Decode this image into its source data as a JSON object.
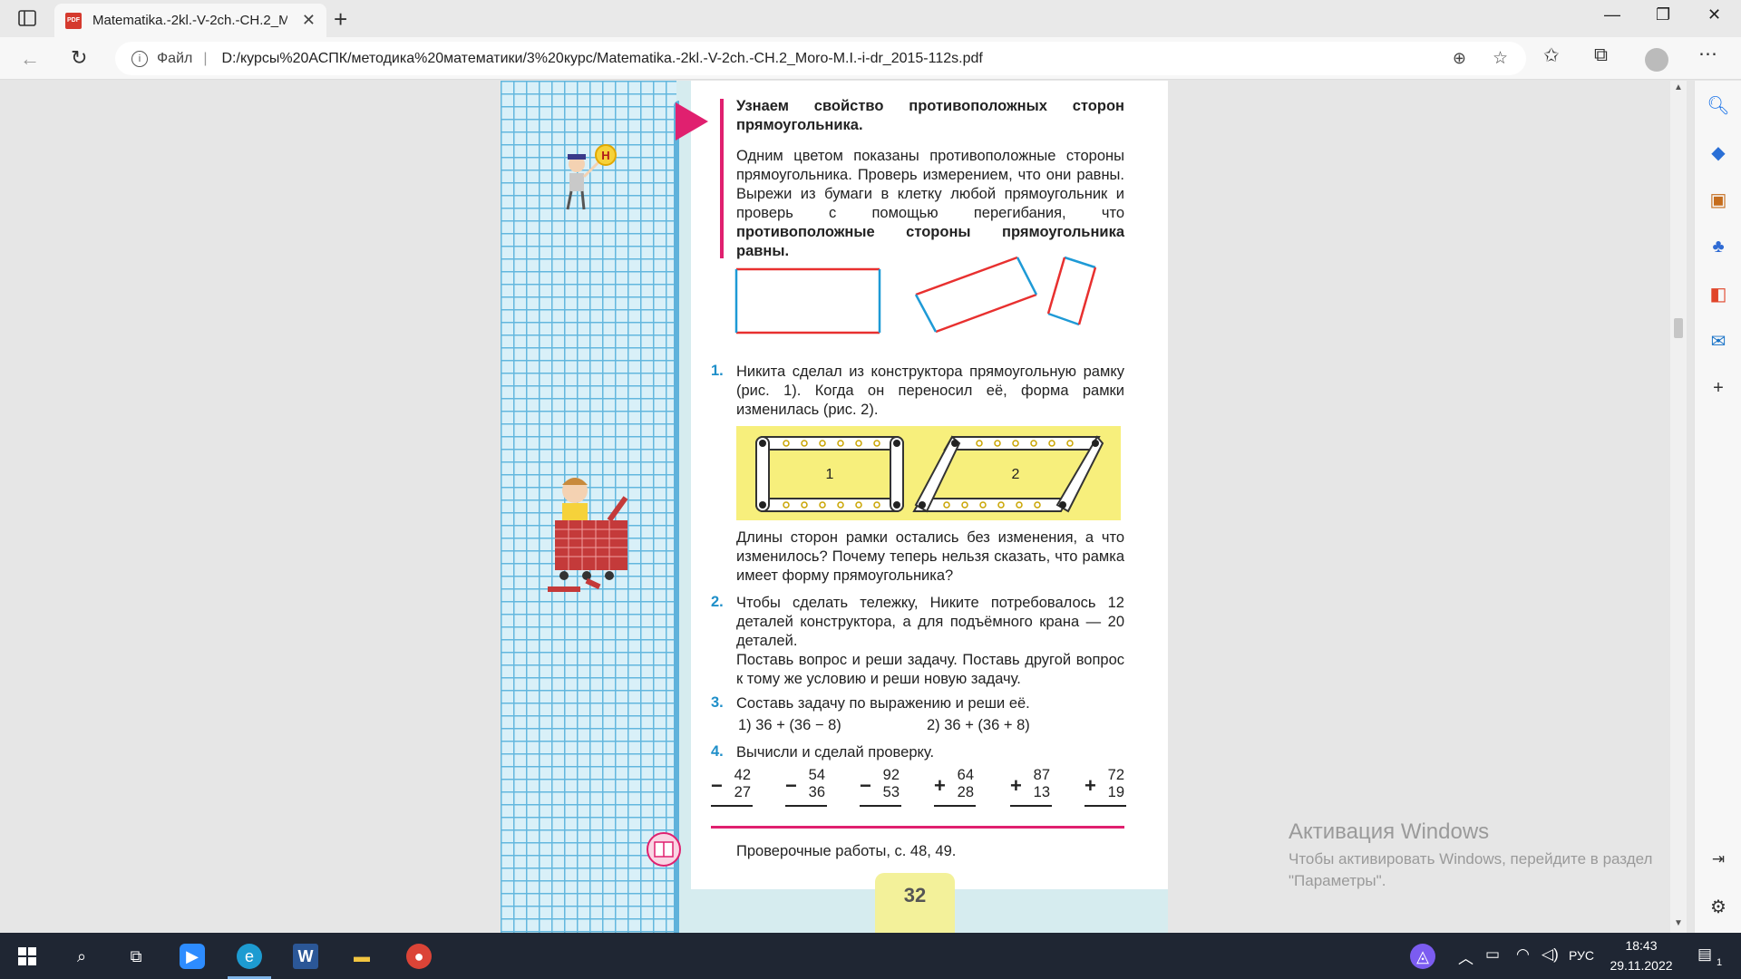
{
  "browser": {
    "tab_title": "Matematika.-2kl.-V-2ch.-CH.2_M",
    "pdf_badge": "PDF",
    "address_prefix": "Файл",
    "address_sep": "|",
    "url": "D:/курсы%20АСПК/методика%20математики/3%20курс/Matematika.-2kl.-V-2ch.-CH.2_Moro-M.I.-i-dr_2015-112s.pdf"
  },
  "page": {
    "intro_1": "Узнаем свойство противоположных сторон прямоугольника.",
    "intro_2_plain": "Одним цветом показаны противоположные стороны прямоугольника. Проверь измерением, что они равны. Вырежи из бумаги в клетку любой прямоугольник и проверь с помощью перегибания, что ",
    "intro_2_bold": "противоположные стороны прямоугольника равны.",
    "task1_num": "1.",
    "task1_text": "Никита сделал из конструктора прямоугольную рамку (рис. 1). Когда он переносил её, форма рамки изменилась (рис. 2).",
    "frame_label_1": "1",
    "frame_label_2": "2",
    "task1_question": "Длины сторон рамки остались без изменения, а что изменилось? Почему теперь нельзя сказать, что рамка имеет форму прямоугольника?",
    "task2_num": "2.",
    "task2_text": "Чтобы сделать тележку, Никите потребовалось 12 деталей конструктора, а для подъёмного крана — 20 деталей.",
    "task2_text_b": "Поставь вопрос и реши задачу. Поставь другой вопрос к тому же условию и реши новую задачу.",
    "task3_num": "3.",
    "task3_text": "Составь задачу по выражению и реши её.",
    "task3_expr1": "1)  36 + (36 − 8)",
    "task3_expr2": "2)  36 + (36 + 8)",
    "task4_num": "4.",
    "task4_text": "Вычисли и сделай проверку.",
    "columns": [
      {
        "sign": "−",
        "top": "42",
        "bottom": "27"
      },
      {
        "sign": "−",
        "top": "54",
        "bottom": "36"
      },
      {
        "sign": "−",
        "top": "92",
        "bottom": "53"
      },
      {
        "sign": "+",
        "top": "64",
        "bottom": "28"
      },
      {
        "sign": "+",
        "top": "87",
        "bottom": "13"
      },
      {
        "sign": "+",
        "top": "72",
        "bottom": "19"
      }
    ],
    "check_works": "Проверочные работы, с. 48, 49.",
    "page_number": "32",
    "badge_letter": "Н"
  },
  "watermark": {
    "title": "Активация Windows",
    "text": "Чтобы активировать Windows, перейдите в раздел \"Параметры\"."
  },
  "taskbar": {
    "lang": "РУС",
    "time": "18:43",
    "date": "29.11.2022",
    "notif_count": "1"
  },
  "colors": {
    "accent_pink": "#e0206f",
    "task_number_blue": "#1f8fc9",
    "grid_blue": "#63b7de",
    "frame_yellow": "#f7ef7c"
  }
}
